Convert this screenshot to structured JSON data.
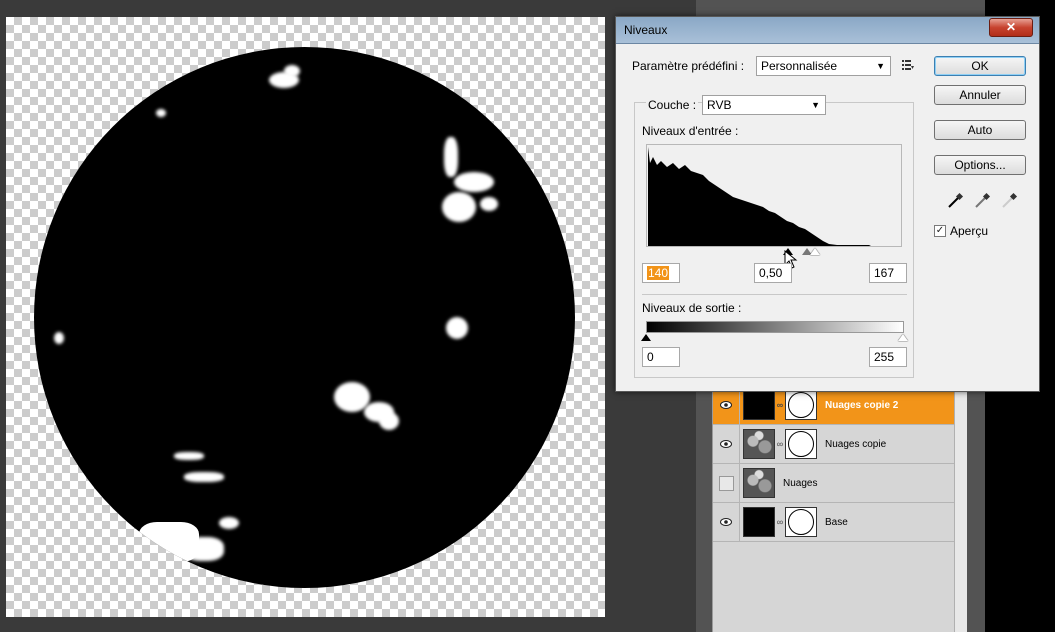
{
  "dialog": {
    "title": "Niveaux",
    "close_label": "✕",
    "preset_label": "Paramètre prédéfini :",
    "preset_value": "Personnalisée",
    "channel_label": "Couche :",
    "channel_value": "RVB",
    "input_levels_label": "Niveaux d'entrée :",
    "input_black": "140",
    "input_gamma": "0,50",
    "input_white": "167",
    "output_levels_label": "Niveaux de sortie :",
    "output_black": "0",
    "output_white": "255",
    "buttons": {
      "ok": "OK",
      "cancel": "Annuler",
      "auto": "Auto",
      "options": "Options..."
    },
    "preview_label": "Aperçu",
    "preview_checked": true
  },
  "layers": [
    {
      "name": "Nuages copie 2",
      "visible": true,
      "selected": true,
      "has_mask": true
    },
    {
      "name": "Nuages copie",
      "visible": true,
      "selected": false,
      "has_mask": true
    },
    {
      "name": "Nuages",
      "visible": false,
      "selected": false,
      "has_mask": false
    },
    {
      "name": "Base",
      "visible": true,
      "selected": false,
      "has_mask": true
    }
  ],
  "colors": {
    "selection": "#f29419",
    "titlebar": "#a9c0d8",
    "close_button": "#c7432f"
  }
}
